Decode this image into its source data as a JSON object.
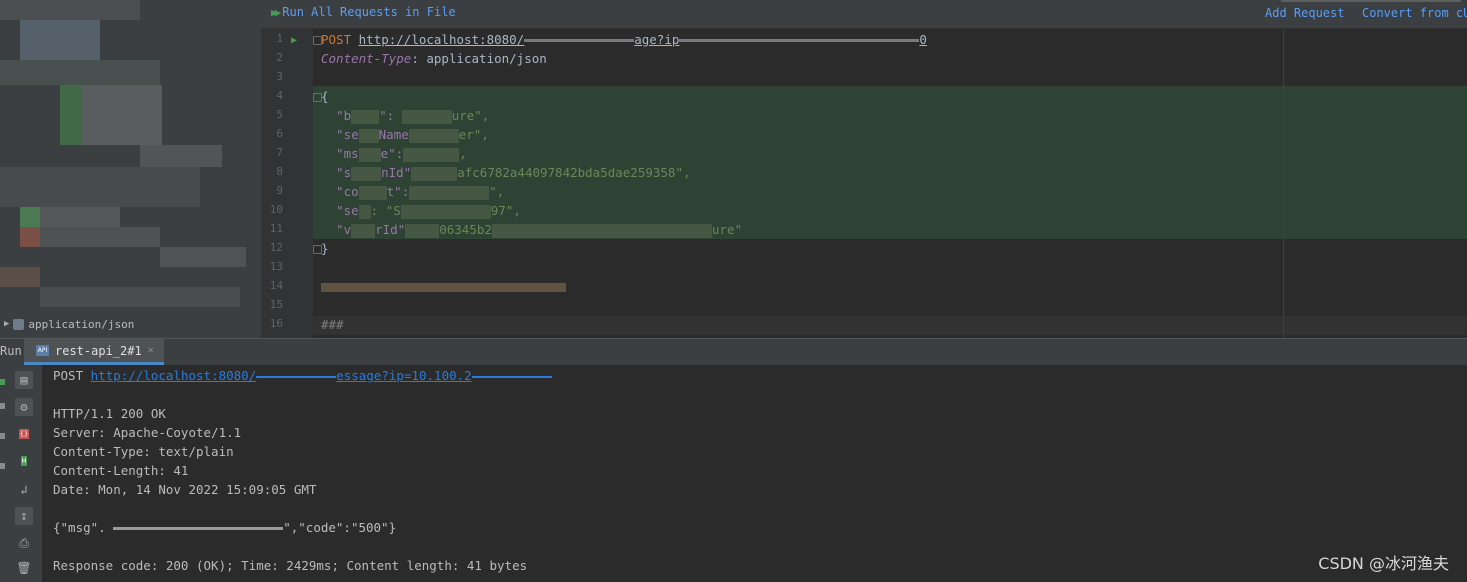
{
  "editor": {
    "toolbar": {
      "run_all": "Run All Requests in File",
      "add_request": "Add Request",
      "convert": "Convert from cU"
    },
    "line_numbers": [
      "1",
      "2",
      "3",
      "4",
      "5",
      "6",
      "7",
      "8",
      "9",
      "10",
      "11",
      "12",
      "13",
      "14",
      "15",
      "16"
    ],
    "lines": {
      "l1_method": "POST",
      "l1_url_a": "http://localhost:8080/",
      "l1_url_b": "age?ip",
      "l1_url_c": "0",
      "l2_header": "Content-Type",
      "l2_value": ": application/json",
      "l4": "{",
      "l5_a": "  \"b",
      "l5_b": "\": ",
      "l5_c": "ure\",",
      "l6_a": "  \"se",
      "l6_b": "Name",
      "l6_c": "er\",",
      "l7_a": "  \"ms",
      "l7_b": "e\":",
      "l7_c": ",",
      "l8_a": "  \"s",
      "l8_b": "nId\"",
      "l8_c": "afc6782a44097842bda5dae259358\",",
      "l9_a": "  \"co",
      "l9_b": "t\":",
      "l9_c": "\",",
      "l10_a": "  \"se",
      "l10_b": ": \"S",
      "l10_c": "97\",",
      "l11_a": "  \"v",
      "l11_b": "rId\"",
      "l11_c": "06345b2",
      "l11_d": "ure\"",
      "l12": "}",
      "l16": "###"
    }
  },
  "left_panel": {
    "tree_item": "application/json"
  },
  "run": {
    "label": "Run:",
    "tab_label": "rest-api_2#1",
    "tab_icon": "API"
  },
  "output": {
    "request_method": "POST ",
    "request_url": "http://localhost:8080/",
    "request_url_tail": "essage?ip=10.100.2",
    "status": "HTTP/1.1 200 OK",
    "server": "Server: Apache-Coyote/1.1",
    "content_type": "Content-Type: text/plain",
    "content_length": "Content-Length: 41",
    "date": "Date: Mon, 14 Nov 2022 15:09:05 GMT",
    "body_a": "{\"msg\". ",
    "body_b": "\",\"code\":\"500\"}",
    "summary": "Response code: 200 (OK); Time: 2429ms; Content length: 41 bytes"
  },
  "watermark": "CSDN @冰河渔夫",
  "icons": {
    "run_all": "play-double-icon",
    "gutter_run": "play-icon",
    "tool_buttons": [
      "request-icon",
      "settings-icon",
      "json-icon",
      "html-icon",
      "soft-wrap-icon",
      "scroll-to-end-icon",
      "print-icon",
      "trash-icon"
    ]
  }
}
